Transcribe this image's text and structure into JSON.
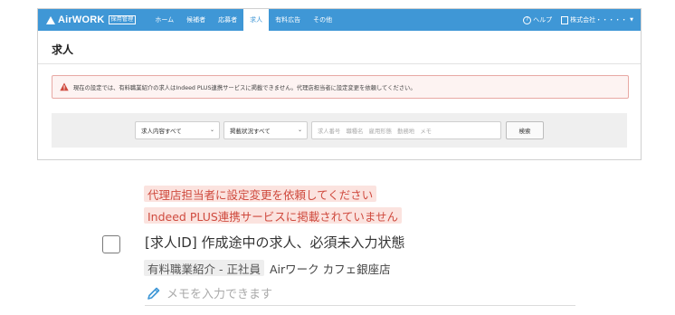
{
  "header": {
    "brand": "AirWORK",
    "brand_badge": "採用管理",
    "nav": [
      "ホーム",
      "候補者",
      "応募者",
      "求人",
      "有料広告",
      "その他"
    ],
    "active_nav": "求人",
    "help_label": "ヘルプ",
    "company_label": "株式会社・・・・・"
  },
  "page": {
    "title": "求人",
    "alert_text": "現在の設定では、有料職業紹介の求人はIndeed PLUS連携サービスに掲載できません。代理店担当者に設定変更を依頼してください。"
  },
  "filters": {
    "content_select": "求人内容すべて",
    "status_select": "掲載状況すべて",
    "search_placeholder": "求人番号　職種名　雇用形態　勤務地　メモ",
    "search_button": "検索"
  },
  "job_card": {
    "warning_1": "代理店担当者に設定変更を依頼してください",
    "warning_2": "Indeed PLUS連携サービスに掲載されていません",
    "title": "[求人ID] 作成途中の求人、必須未入力状態",
    "employment_tag": "有料職業紹介 - 正社員",
    "store": "Airワーク カフェ銀座店",
    "memo_placeholder": "メモを入力できます"
  },
  "colors": {
    "header_blue": "#3f97d6",
    "alert_red": "#cf4a3e",
    "alert_bg": "#fdf3f2"
  },
  "icons": [
    "help-icon",
    "building-icon",
    "warning-icon",
    "chevron-down-icon",
    "pencil-icon"
  ]
}
